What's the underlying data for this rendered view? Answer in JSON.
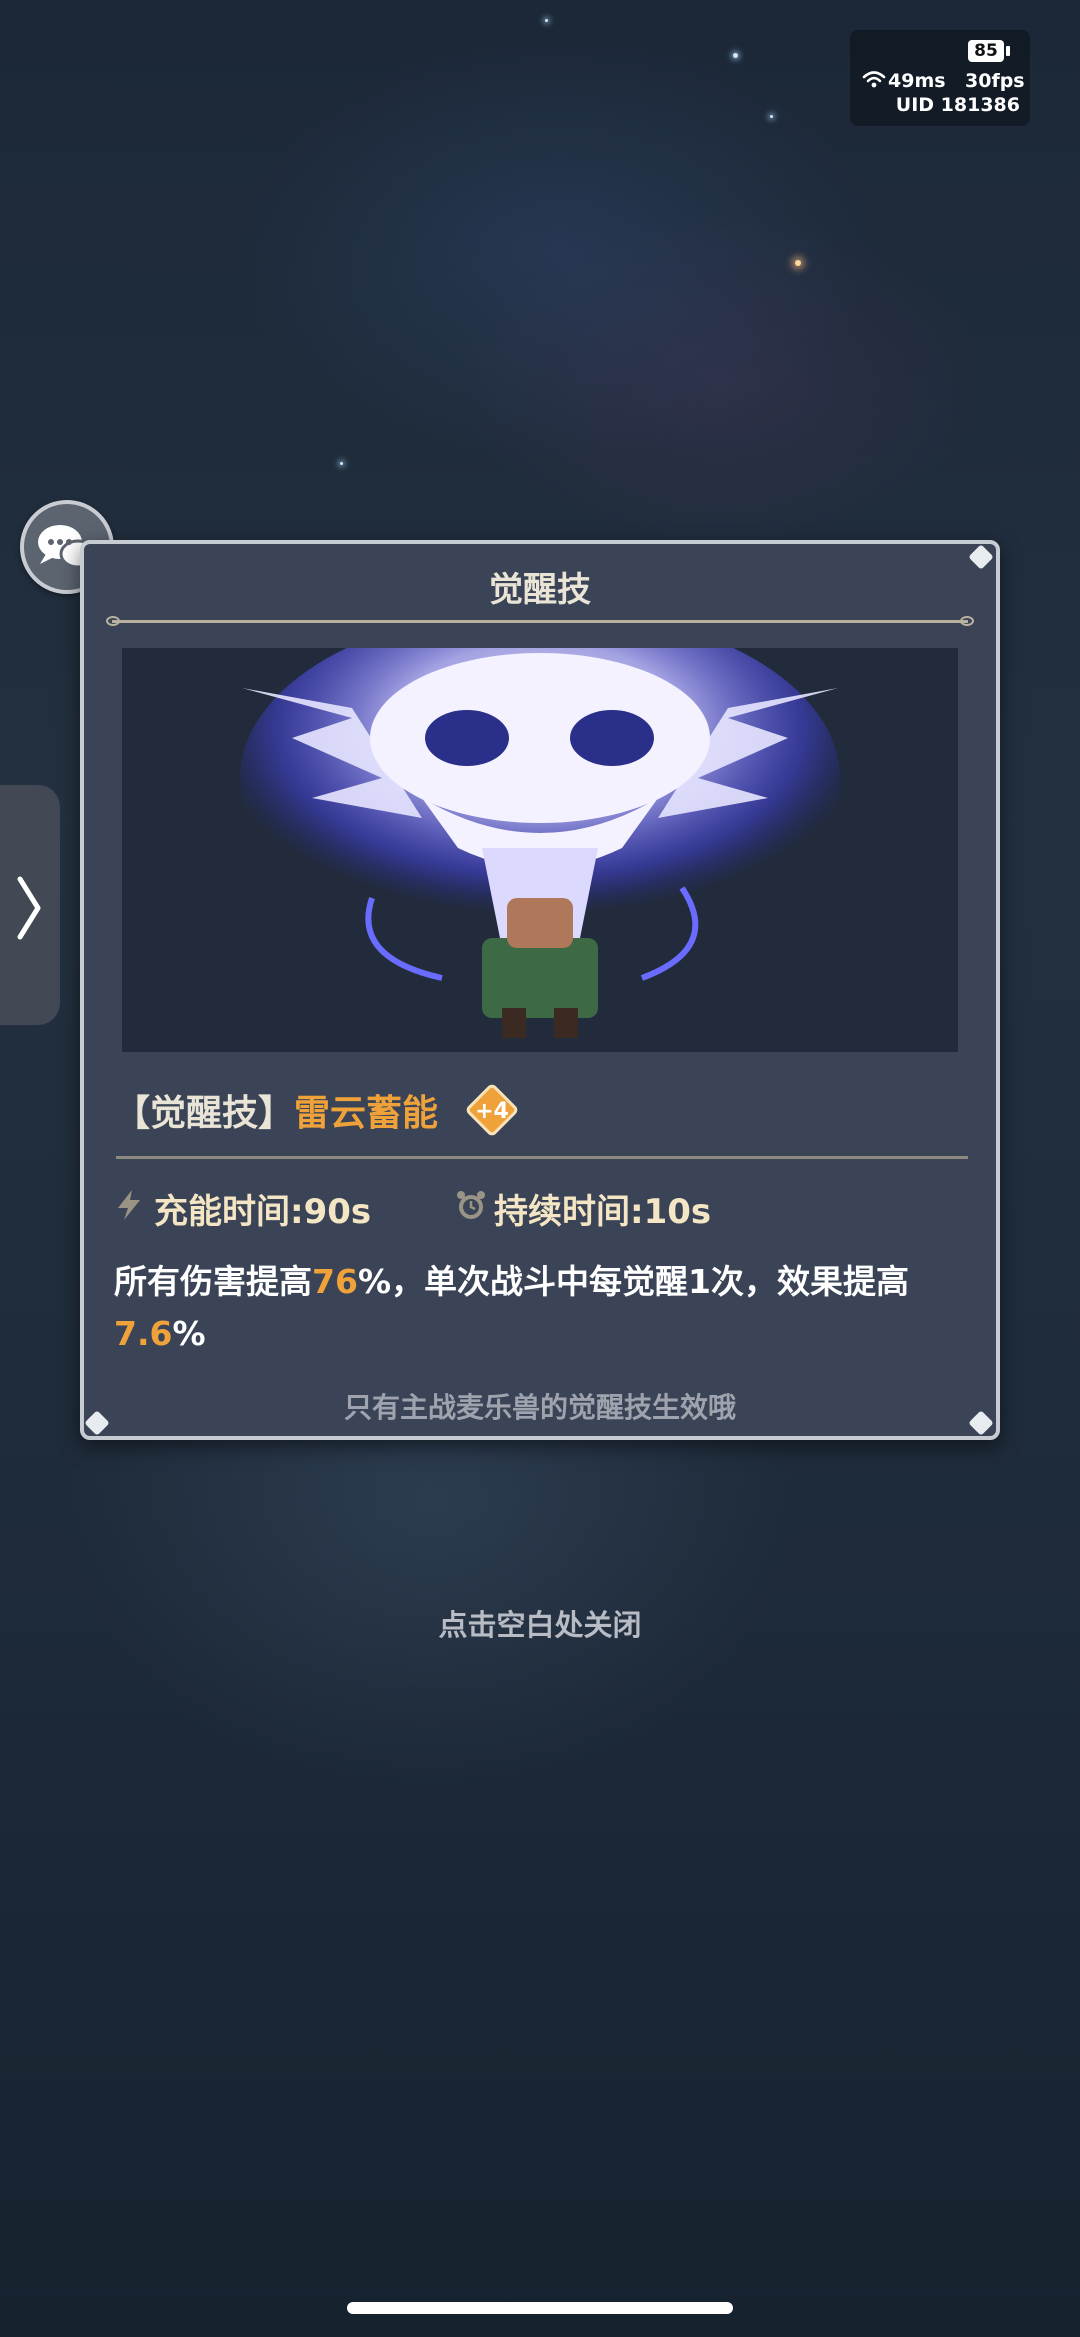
{
  "status_hud": {
    "battery": "85",
    "ping": "49ms",
    "fps": "30fps",
    "uid": "UID 181386"
  },
  "panel": {
    "title": "觉醒技",
    "skill_bracket_open": "【",
    "skill_type": "觉醒技",
    "skill_bracket_close": "】",
    "skill_name": "雷云蓄能",
    "level_badge": "+4",
    "charge_time": "充能时间:90s",
    "duration": "持续时间:10s",
    "description": {
      "part1": "所有伤害提高",
      "value1": "76",
      "part2": "%，单次战斗中每觉醒1次，效果提高",
      "value2": "7.6",
      "part3": "%"
    },
    "note": "只有主战麦乐兽的觉醒技生效哦"
  },
  "close_hint": "点击空白处关闭",
  "colors": {
    "highlight": "#f0a23a",
    "panel_bg": "#3a4456",
    "panel_border": "#c7ccd3"
  },
  "icons": {
    "chat": "chat-bubbles-icon",
    "side_tab": "chevron-right-icon",
    "charge": "lightning-icon",
    "duration": "alarm-clock-icon",
    "wifi": "wifi-icon"
  }
}
